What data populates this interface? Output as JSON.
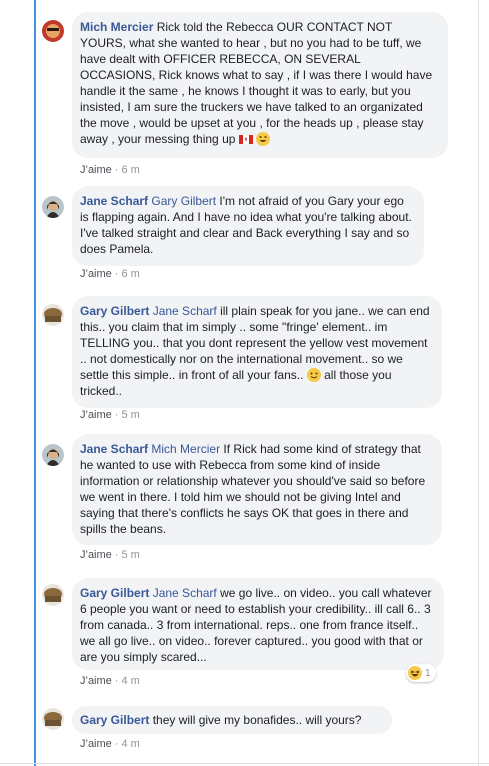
{
  "comments": [
    {
      "author": "Mich Mercier",
      "mention": "",
      "text": "Rick told the Rebecca OUR CONTACT NOT YOURS, what she wanted to hear , but no you had to be tuff, we have dealt with OFFICER REBECCA, ON SEVERAL OCCASIONS, Rick knows what to say , if I was there I would have handle it the same , he knows I thought it was to early, but you insisted, I am sure the truckers we have talked to an organizated the move , would be upset at you , for the heads up , please stay away , your messing thing up",
      "like_label": "J’aime",
      "time": "6 m"
    },
    {
      "author": "Jane Scharf",
      "mention": "Gary Gilbert",
      "text": "I'm not afraid of you Gary your ego is flapping again. And I have no idea what you're talking about. I've talked straight and clear and Back everything I say and so does Pamela.",
      "like_label": "J’aime",
      "time": "6 m"
    },
    {
      "author": "Gary Gilbert",
      "mention": "Jane Scharf",
      "text": "ill plain speak for you jane.. we can end this.. you claim that im simply .. some \"fringe' element.. im TELLING you.. that you dont represent the yellow vest movement .. not domestically nor on the international movement.. so we settle this simple.. in front of all your fans..",
      "text_after_emoji": " all those you tricked..",
      "like_label": "J’aime",
      "time": "5 m"
    },
    {
      "author": "Jane Scharf",
      "mention": "Mich Mercier",
      "text": "If Rick had some kind of strategy that he wanted to use with Rebecca from some kind of inside information or relationship whatever you should've said so before we went in there. I told him we should not be giving Intel and saying that there's conflicts he says OK that goes in there and spills the beans.",
      "like_label": "J’aime",
      "time": "5 m"
    },
    {
      "author": "Gary Gilbert",
      "mention": "Jane Scharf",
      "text": "we go live.. on video.. you call whatever 6 people you want or need to establish your credibility.. ill call 6.. 3 from canada.. 3 from international. reps.. one from france itself.. we all go live.. on video.. forever captured.. you good with that or are you simply scared...",
      "like_label": "J’aime",
      "time": "4 m",
      "reaction_count": "1"
    },
    {
      "author": "Gary Gilbert",
      "mention": "",
      "text": "they will give my bonafides.. will yours?",
      "like_label": "J’aime",
      "time": "4 m"
    }
  ],
  "colors": {
    "author": "#385898",
    "bubble": "#f2f3f5",
    "meta": "#90949c",
    "thread_highlight": "#4a90e2"
  },
  "icons": {
    "flag": "canada-flag-icon",
    "grin": "grinning-emoji-icon",
    "smile": "smile-emoji-icon",
    "laugh_reaction": "laughing-reaction-icon"
  }
}
